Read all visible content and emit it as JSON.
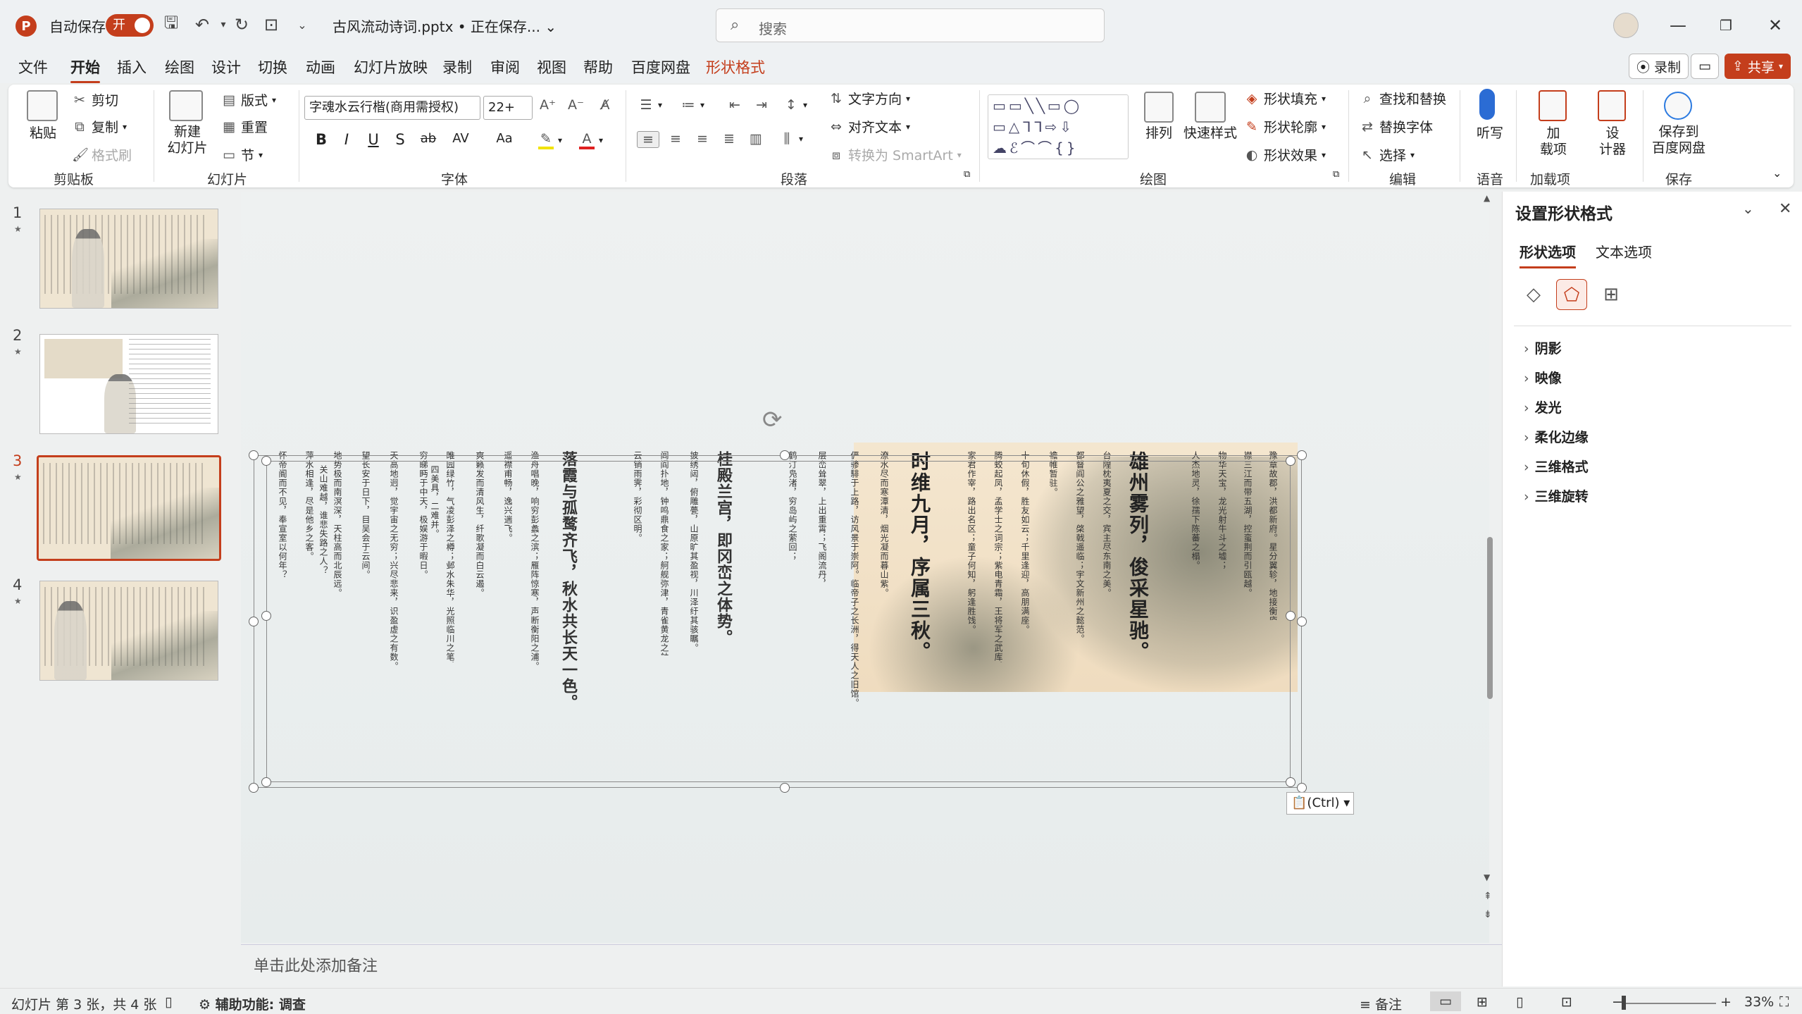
{
  "titlebar": {
    "autosave_label": "自动保存",
    "autosave_state": "开",
    "doc_title": "古风流动诗词.pptx • 正在保存... ⌄",
    "search_placeholder": "搜索"
  },
  "menu": {
    "tabs": [
      "文件",
      "开始",
      "插入",
      "绘图",
      "设计",
      "切换",
      "动画",
      "幻灯片放映",
      "录制",
      "审阅",
      "视图",
      "帮助",
      "百度网盘",
      "形状格式"
    ],
    "active": "开始",
    "record_label": "录制",
    "share_label": "共享"
  },
  "ribbon": {
    "clipboard": {
      "paste": "粘贴",
      "cut": "剪切",
      "copy": "复制",
      "format_painter": "格式刷",
      "label": "剪贴板"
    },
    "slides": {
      "new_slide": "新建\n幻灯片",
      "layout": "版式",
      "reset": "重置",
      "section": "节",
      "label": "幻灯片"
    },
    "font": {
      "font_name": "字魂水云行楷(商用需授权)",
      "font_size": "22+",
      "bold": "B",
      "italic": "I",
      "underline": "U",
      "shadow": "S",
      "strike": "ab",
      "spacing": "AV",
      "case": "Aa",
      "label": "字体"
    },
    "paragraph": {
      "text_direction": "文字方向",
      "align_text": "对齐文本",
      "smartart": "转换为 SmartArt",
      "label": "段落"
    },
    "drawing": {
      "arrange": "排列",
      "quick_styles": "快速样式",
      "fill": "形状填充",
      "outline": "形状轮廓",
      "effects": "形状效果",
      "label": "绘图"
    },
    "editing": {
      "find_replace": "查找和替换",
      "replace_font": "替换字体",
      "select": "选择",
      "label": "编辑"
    },
    "voice": {
      "dictate": "听写",
      "label": "语音"
    },
    "addins": {
      "addins": "加\n载项",
      "label": "加载项"
    },
    "designer": {
      "designer": "设\n计器"
    },
    "save": {
      "save_baidu": "保存到\n百度网盘",
      "label": "保存"
    }
  },
  "thumbnails": [
    {
      "num": "1",
      "star": "★"
    },
    {
      "num": "2",
      "star": "★"
    },
    {
      "num": "3",
      "star": "★",
      "active": true
    },
    {
      "num": "4",
      "star": "★"
    }
  ],
  "slide": {
    "big_lines": [
      "雄州雾列，俊采星驰。",
      "时维九月，序属三秋。",
      "桂殿兰宫，即冈峦之体势。",
      "落霞与孤鹜齐飞，秋水共长天一色。"
    ],
    "small_lines": [
      "豫章故郡，洪都新府。星分翼轸，地接衡庐。",
      "襟三江而带五湖，控蛮荆而引瓯越。",
      "物华天宝，龙光射牛斗之墟；",
      "人杰地灵，徐孺下陈蕃之榻。",
      "台隍枕夷夏之交，宾主尽东南之美。",
      "都督阎公之雅望，棨戟遥临；宇文新州之懿范。",
      "襜帷暂驻。",
      "十旬休假，胜友如云；千里逢迎，高朋满座。",
      "腾蛟起凤，孟学士之词宗；紫电青霜，王将军之武库。",
      "家君作宰，路出名区；童子何知，躬逢胜饯。",
      "潦水尽而寒潭清，烟光凝而暮山紫。",
      "俨骖騑于上路，访风景于崇阿。临帝子之长洲，得天人之旧馆。",
      "层峦耸翠，上出重霄；飞阁流丹，下临无地。",
      "鹤汀凫渚，穷岛屿之萦回；",
      "披绣闼，俯雕甍，山原旷其盈视，川泽纡其骇瞩。",
      "闾阎扑地，钟鸣鼎食之家；舸舰弥津，青雀黄龙之舳。",
      "云销雨霁，彩彻区明。",
      "渔舟唱晚，响穷彭蠡之滨；雁阵惊寒，声断衡阳之浦。",
      "遥襟甫畅，逸兴遄飞。",
      "爽籁发而清风生，纤歌凝而白云遏。",
      "睢园绿竹，气凌彭泽之樽；邺水朱华，光照临川之笔。",
      "四美具，二难并。",
      "穷睇眄于中天，极娱游于暇日。",
      "天高地迥，觉宇宙之无穷；兴尽悲来，识盈虚之有数。",
      "望长安于日下，目吴会于云间。",
      "地势极而南溟深，天柱高而北辰远。",
      "关山难越，谁悲失路之人？",
      "萍水相逢，尽是他乡之客。",
      "怀帝阍而不见，奉宣室以何年？"
    ],
    "paste_label": "(Ctrl)"
  },
  "notes_placeholder": "单击此处添加备注",
  "format_pane": {
    "title": "设置形状格式",
    "tabs": [
      "形状选项",
      "文本选项"
    ],
    "items": [
      "阴影",
      "映像",
      "发光",
      "柔化边缘",
      "三维格式",
      "三维旋转"
    ]
  },
  "statusbar": {
    "slide_info": "幻灯片 第 3 张，共 4 张",
    "accessibility": "辅助功能: 调查",
    "notes": "备注",
    "zoom": "33%"
  },
  "colors": {
    "accent": "#c43e1c"
  }
}
